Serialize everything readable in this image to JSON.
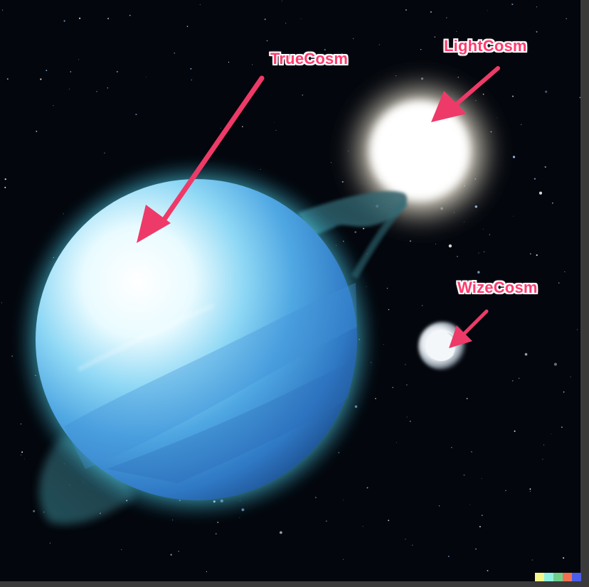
{
  "labels": {
    "truecosm": "TrueCosm",
    "lightcosm": "LightCosm",
    "wizecosm": "WizeCosm"
  },
  "colors": {
    "space": "#03060c",
    "planet_light": "#e8fbff",
    "planet_mid": "#5cb8e8",
    "planet_dark": "#2a6fb8",
    "glow": "#7ff3ff",
    "arrow": "#ee3a68",
    "star_core": "#ffffff",
    "moon": "#f2f4f6"
  },
  "signature_colors": [
    "#f5f58a",
    "#8ef0e0",
    "#6fcf8a",
    "#f07050",
    "#4a5ee8"
  ]
}
